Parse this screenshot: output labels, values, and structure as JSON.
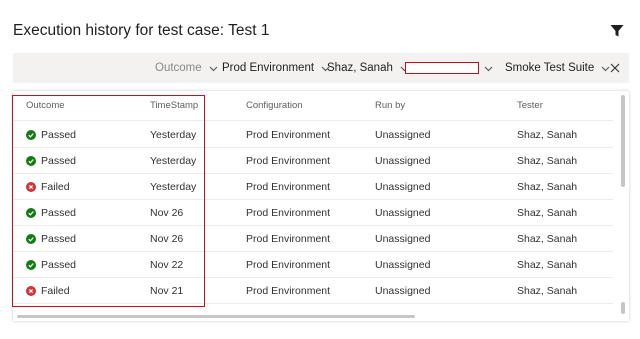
{
  "title": "Execution history for test case: Test 1",
  "filters": {
    "outcome": "Outcome",
    "configuration": "Prod Environment",
    "tester": "Shaz, Sanah",
    "run_by": "",
    "suite": "Smoke Test Suite"
  },
  "columns": [
    "Outcome",
    "TimeStamp",
    "Configuration",
    "Run by",
    "Tester"
  ],
  "rows": [
    {
      "outcome": "Passed",
      "timestamp": "Yesterday",
      "configuration": "Prod Environment",
      "run_by": "Unassigned",
      "tester": "Shaz, Sanah"
    },
    {
      "outcome": "Passed",
      "timestamp": "Yesterday",
      "configuration": "Prod Environment",
      "run_by": "Unassigned",
      "tester": "Shaz, Sanah"
    },
    {
      "outcome": "Failed",
      "timestamp": "Yesterday",
      "configuration": "Prod Environment",
      "run_by": "Unassigned",
      "tester": "Shaz, Sanah"
    },
    {
      "outcome": "Passed",
      "timestamp": "Nov 26",
      "configuration": "Prod Environment",
      "run_by": "Unassigned",
      "tester": "Shaz, Sanah"
    },
    {
      "outcome": "Passed",
      "timestamp": "Nov 26",
      "configuration": "Prod Environment",
      "run_by": "Unassigned",
      "tester": "Shaz, Sanah"
    },
    {
      "outcome": "Passed",
      "timestamp": "Nov 22",
      "configuration": "Prod Environment",
      "run_by": "Unassigned",
      "tester": "Shaz, Sanah"
    },
    {
      "outcome": "Failed",
      "timestamp": "Nov 21",
      "configuration": "Prod Environment",
      "run_by": "Unassigned",
      "tester": "Shaz, Sanah"
    }
  ],
  "colors": {
    "passed": "#107c10",
    "failed": "#d13438",
    "highlight": "#c50f1f",
    "filter_bar": "#f3f2f1"
  },
  "icons": {
    "filter": "funnel-icon",
    "dropdown": "chevron-down-icon",
    "close": "close-icon",
    "passed": "check-circle-icon",
    "failed": "error-circle-icon"
  }
}
